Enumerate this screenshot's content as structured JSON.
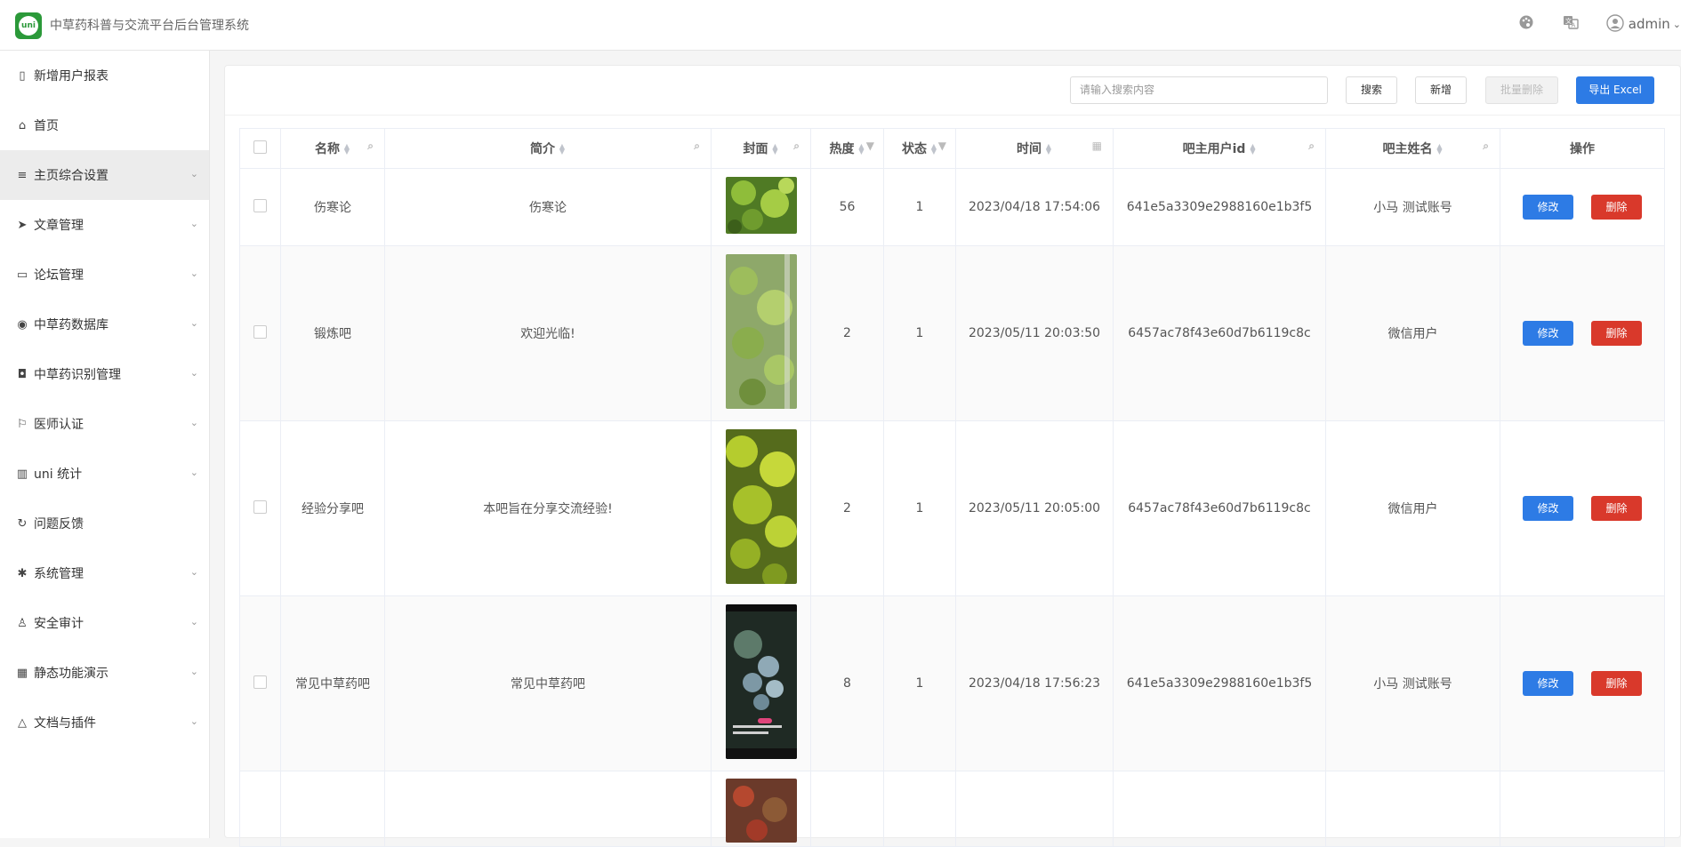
{
  "app": {
    "logo_text": "uni",
    "title": "中草药科普与交流平台后台管理系统"
  },
  "topbar": {
    "user": "admin"
  },
  "sidebar": {
    "items": [
      {
        "label": "新增用户报表",
        "icon": "map-icon",
        "has_children": false,
        "active": false
      },
      {
        "label": "首页",
        "icon": "home-icon",
        "has_children": false,
        "active": false
      },
      {
        "label": "主页综合设置",
        "icon": "sliders-icon",
        "has_children": true,
        "active": true
      },
      {
        "label": "文章管理",
        "icon": "send-icon",
        "has_children": true,
        "active": false
      },
      {
        "label": "论坛管理",
        "icon": "chat-icon",
        "has_children": true,
        "active": false
      },
      {
        "label": "中草药数据库",
        "icon": "database-icon",
        "has_children": true,
        "active": false
      },
      {
        "label": "中草药识别管理",
        "icon": "camera-icon",
        "has_children": true,
        "active": false
      },
      {
        "label": "医师认证",
        "icon": "flag-icon",
        "has_children": true,
        "active": false
      },
      {
        "label": "uni 统计",
        "icon": "chart-icon",
        "has_children": true,
        "active": false
      },
      {
        "label": "问题反馈",
        "icon": "refresh-icon",
        "has_children": false,
        "active": false
      },
      {
        "label": "系统管理",
        "icon": "gear-icon",
        "has_children": true,
        "active": false
      },
      {
        "label": "安全审计",
        "icon": "user-icon",
        "has_children": true,
        "active": false
      },
      {
        "label": "静态功能演示",
        "icon": "grid-icon",
        "has_children": true,
        "active": false
      },
      {
        "label": "文档与插件",
        "icon": "plugin-icon",
        "has_children": true,
        "active": false
      }
    ]
  },
  "toolbar": {
    "search_placeholder": "请输入搜索内容",
    "search_label": "搜索",
    "add_label": "新增",
    "batch_delete_label": "批量删除",
    "export_label": "导出 Excel"
  },
  "table": {
    "columns": [
      "名称",
      "简介",
      "封面",
      "热度",
      "状态",
      "时间",
      "吧主用户id",
      "吧主姓名",
      "操作"
    ],
    "edit_label": "修改",
    "delete_label": "删除",
    "rows": [
      {
        "name": "伤寒论",
        "intro": "伤寒论",
        "heat": "56",
        "status": "1",
        "time": "2023/04/18 17:54:06",
        "owner_id": "641e5a3309e2988160e1b3f5",
        "owner_name": "小马 测试账号"
      },
      {
        "name": "锻炼吧",
        "intro": "欢迎光临!",
        "heat": "2",
        "status": "1",
        "time": "2023/05/11 20:03:50",
        "owner_id": "6457ac78f43e60d7b6119c8c",
        "owner_name": "微信用户"
      },
      {
        "name": "经验分享吧",
        "intro": "本吧旨在分享交流经验!",
        "heat": "2",
        "status": "1",
        "time": "2023/05/11 20:05:00",
        "owner_id": "6457ac78f43e60d7b6119c8c",
        "owner_name": "微信用户"
      },
      {
        "name": "常见中草药吧",
        "intro": "常见中草药吧",
        "heat": "8",
        "status": "1",
        "time": "2023/04/18 17:56:23",
        "owner_id": "641e5a3309e2988160e1b3f5",
        "owner_name": "小马 测试账号"
      }
    ]
  }
}
